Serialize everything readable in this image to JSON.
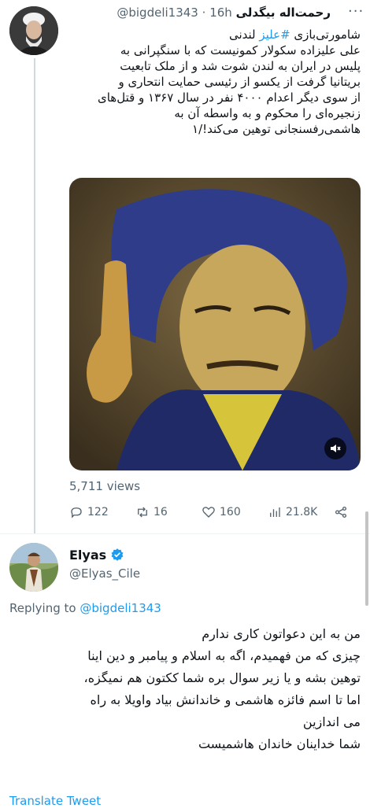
{
  "tweet": {
    "author_name": "رحمت‌اله بیگدلی",
    "handle": "@bigdeli1343",
    "separator": "·",
    "time": "16h",
    "more_label": "···",
    "text_lines": [
      {
        "before": "شامورتی‌بازی ",
        "hashtag": "#علیز",
        "after": " لندنی"
      },
      {
        "before": "علی علیزاده سکولار کمونیست که با سنگپرانی به"
      },
      {
        "before": "پلیس در ایران به لندن شوت شد و از ملک تابعیت"
      },
      {
        "before": "بریتانیا گرفت از یکسو از رئیسی حمایت انتحاری و"
      },
      {
        "before": "از سوی دیگر اعدام ۴۰۰۰ نفر در سال ۱۳۶۷ و قتل‌های"
      },
      {
        "before": "زنجیره‌ای را محکوم و به واسطه آن به"
      },
      {
        "before": "هاشمی‌رفسنجانی توهین می‌کند!/۱"
      }
    ],
    "views": "5,711 views",
    "stats": {
      "replies": "122",
      "retweets": "16",
      "likes": "160",
      "analytics": "21.8K"
    }
  },
  "reply": {
    "author_name": "Elyas",
    "handle": "@Elyas_Cile",
    "replying_prefix": "Replying to",
    "replying_to": "@bigdeli1343",
    "text_lines": [
      "من به این دعواتون کاری ندارم",
      "چیزی که من فهمیدم، اگه به اسلام و پیامبر و دین اینا",
      "توهین بشه و یا زیر سوال بره شما ککتون هم نمیگزه،",
      "اما تا اسم فائزه هاشمی و خاندانش بیاد واویلا به راه",
      "می اندازین",
      "شما خداینان خاندان هاشمیست"
    ],
    "footer_partial": "Translate Tweet"
  },
  "colors": {
    "accent": "#1d9bf0",
    "muted": "#536471",
    "divider": "#eff3f4"
  },
  "icons": [
    "more-icon",
    "mute-icon",
    "reply-icon",
    "retweet-icon",
    "like-icon",
    "analytics-icon",
    "share-icon",
    "verified-icon"
  ]
}
